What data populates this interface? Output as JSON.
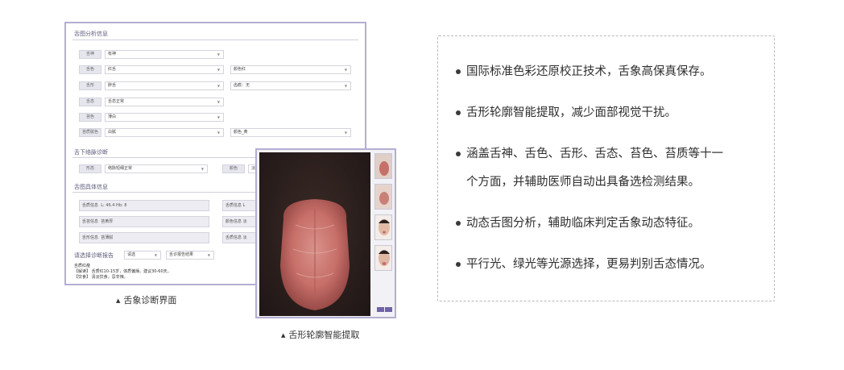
{
  "form_panel": {
    "section1_title": "舌图分析信息",
    "rows": [
      {
        "label": "舌神",
        "value": "有神",
        "extra_value": ""
      },
      {
        "label": "舌色",
        "value": "红舌",
        "extra_value": "颜色红"
      },
      {
        "label": "舌形",
        "value": "胖舌",
        "extra_value": "齿痕：无"
      },
      {
        "label": "舌态",
        "value": "舌态正常",
        "extra_value": ""
      },
      {
        "label": "苔色",
        "value": "薄白",
        "extra_value": ""
      },
      {
        "label": "苔质腻色",
        "value": "白腻",
        "extra_value": "颜色_黄"
      }
    ],
    "section2_title": "舌下络脉诊断",
    "sub_row": {
      "label1": "形态",
      "value1": "络脉短细正常",
      "label2": "颜色",
      "value2": "淡紫"
    },
    "section3_title": "舌图具体信息",
    "detail_rows": [
      {
        "label": "舌质信息",
        "value": "L: 46.4  Hb: 8",
        "label2": "舌质信息",
        "value2": "L"
      },
      {
        "label": "舌苔信息",
        "value": "苔黄厚",
        "label2": "颜色信息",
        "value2": "淡"
      },
      {
        "label": "舌形信息",
        "value": "苔薄腻",
        "label2": "舌质信息",
        "value2": "淡"
      }
    ],
    "section4_title": "请选择诊断报告",
    "report_select1": "请选",
    "report_select2": "舌诊报告结果",
    "note_lines": [
      "舌质红瘦",
      "【解读】 舌质红10-15岁，体质偏燥。建议30-60天。",
      "【饮食】 清淡饮食，忌辛辣。"
    ]
  },
  "tongue_panel": {
    "thumbnails": [
      "tongue-thumb-1",
      "tongue-thumb-2",
      "face-thumb-1",
      "face-thumb-2"
    ]
  },
  "captions": {
    "left": "舌象诊断界面",
    "center": "舌形轮廓智能提取"
  },
  "features": [
    {
      "line1": "国际标准色彩还原校正技术，舌象高保真保存。",
      "line2": ""
    },
    {
      "line1": "舌形轮廓智能提取，减少面部视觉干扰。",
      "line2": ""
    },
    {
      "line1": "涵盖舌神、舌色、舌形、舌态、苔色、苔质等十一",
      "line2": "个方面，并辅助医师自动出具备选检测结果。"
    },
    {
      "line1": "动态舌图分析，辅助临床判定舌象动态特征。",
      "line2": ""
    },
    {
      "line1": "平行光、绿光等光源选择，更易判别舌态情况。",
      "line2": ""
    }
  ],
  "colors": {
    "accent": "#b4aed1",
    "button": "#7063a8",
    "tongue": "#c96f6a"
  }
}
